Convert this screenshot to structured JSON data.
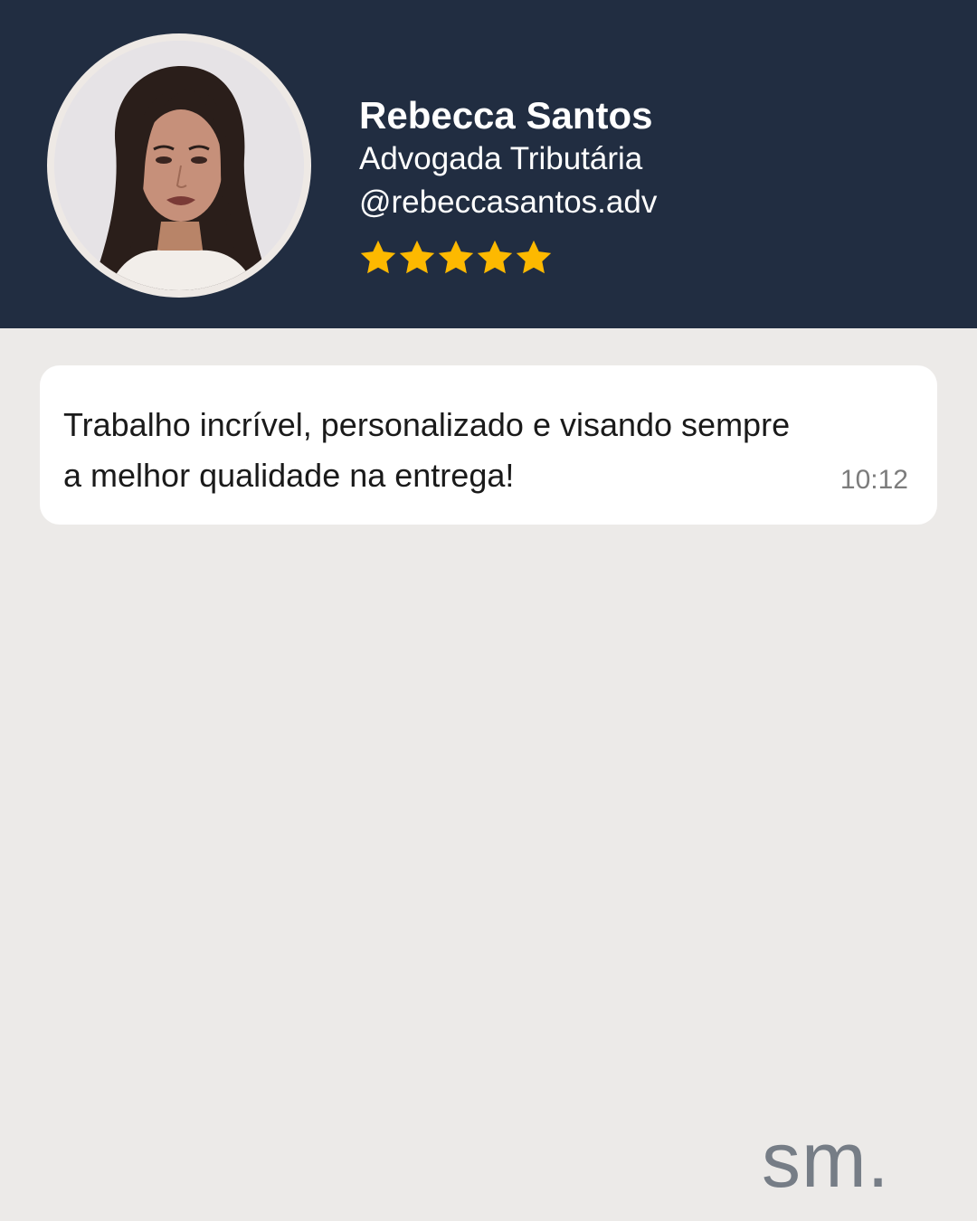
{
  "profile": {
    "name": "Rebecca Santos",
    "role": "Advogada Tributária",
    "handle": "@rebeccasantos.adv",
    "rating": 5,
    "rating_max": 5,
    "star_color": "#FDB900"
  },
  "message": {
    "text": "Trabalho incrível, personalizado e visando sempre a melhor qualidade na entrega!",
    "time": "10:12"
  },
  "brand": {
    "logo_text": "sm."
  },
  "colors": {
    "header_bg": "#212D41",
    "page_bg": "#ECEAE8",
    "bubble_bg": "#FFFFFF"
  }
}
